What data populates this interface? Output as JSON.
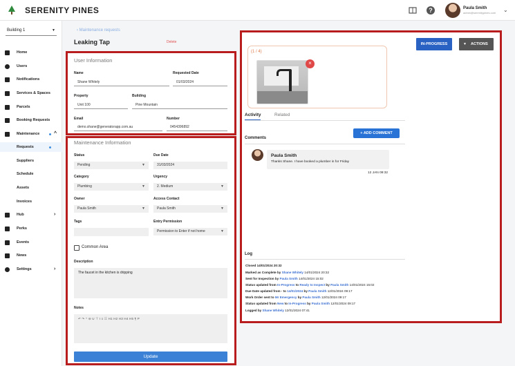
{
  "app": {
    "brand": "SERENITY PINES"
  },
  "user": {
    "name": "Paula Smith",
    "email": "admin@serenitypines.com"
  },
  "sidebar": {
    "building": "Building 1",
    "items": [
      {
        "label": "Home",
        "icon": "home-icon"
      },
      {
        "label": "Users",
        "icon": "user-icon"
      },
      {
        "label": "Notifications",
        "icon": "megaphone-icon"
      },
      {
        "label": "Services & Spaces",
        "icon": "briefcase-icon"
      },
      {
        "label": "Parcels",
        "icon": "parcel-icon"
      },
      {
        "label": "Booking Requests",
        "icon": "calendar-icon"
      },
      {
        "label": "Maintenance",
        "icon": "wrench-icon"
      },
      {
        "label": "Hub",
        "icon": "grid-icon"
      },
      {
        "label": "Perks",
        "icon": "tag-icon"
      },
      {
        "label": "Events",
        "icon": "crown-icon"
      },
      {
        "label": "News",
        "icon": "news-icon"
      },
      {
        "label": "Settings",
        "icon": "gear-icon"
      }
    ],
    "maintenance_sub": [
      "Requests",
      "Suppliers",
      "Schedule",
      "Assets",
      "Invoices"
    ]
  },
  "header": {
    "back": "Maintenance requests",
    "title": "Leaking Tap",
    "delete": "Delete"
  },
  "user_info": {
    "section": "User Information",
    "name_label": "Name",
    "name": "Shane Whitely",
    "req_date_label": "Requested Date",
    "req_date": "01/03/2024",
    "property_label": "Property",
    "property": "Unit 100",
    "building_label": "Building",
    "building": "Pine Mountain",
    "email_label": "Email",
    "email": "demo.shane@generatorapp.com.au",
    "number_label": "Number",
    "number": "0454396892"
  },
  "maint_info": {
    "section": "Maintenance Information",
    "status_label": "Status",
    "status": "Pending",
    "due_label": "Due Date",
    "due": "31/03/2024",
    "category_label": "Category",
    "category": "Plumbing",
    "urgency_label": "Urgency",
    "urgency": "2. Medium",
    "owner_label": "Owner",
    "owner": "Paula Smith",
    "access_label": "Access Contact",
    "access": "Paula Smith",
    "tags_label": "Tags",
    "entry_label": "Entry Permission",
    "entry": "Permission to Enter if not home",
    "common_area": "Common Area",
    "desc_label": "Description",
    "desc": "The faucet in the kitchen is dripping",
    "notes_label": "Notes",
    "toolbar": "↶ ↷ ⁼ ⊖ U ⊤ I ≡ ☷ H1 H2 H3 H4 H5 ¶ P",
    "update": "Update"
  },
  "panel": {
    "photo_count": "(1 / 4)",
    "in_progress": "IN-PROGRESS",
    "actions": "ACTIONS",
    "tab_activity": "Activity",
    "tab_related": "Related",
    "comments": "Comments",
    "add_comment": "+ ADD COMMENT",
    "comment": {
      "name": "Paula Smith",
      "text": "Thanks Shane. I have booked a plumber in for Friday",
      "time": "12 JAN 09:32"
    },
    "log_title": "Log",
    "log": {
      "l1": "Closed 14/01/2024 20:32",
      "l2a": "Marked as Complete by ",
      "l2b": "Shane Whitely",
      "l2c": " 14/01/2024 20:32",
      "l3a": "Sent for Inspection by ",
      "l3b": "Paula Smith",
      "l3c": " 14/01/2024 15:02",
      "l4a": "Status updated from ",
      "l4b": "In-Progress",
      "l4c": " to ",
      "l4d": "Ready to Inspect",
      "l4e": " by ",
      "l4f": "Paula Smith",
      "l4g": " 14/01/2024 15:02",
      "l5a": "Due Date updated from  - to ",
      "l5b": "14/01/2024",
      "l5c": " by ",
      "l5d": "Paula Smith",
      "l5e": " 12/01/2024 09:17",
      "l6a": "Work Order sent to ",
      "l6b": "Mr Emergency",
      "l6c": " by ",
      "l6d": "Paula Smith",
      "l6e": " 12/01/2024 09:17",
      "l7a": "Status updated from ",
      "l7b": "New",
      "l7c": " to ",
      "l7d": "In-Progress",
      "l7e": " by ",
      "l7f": "Paula Smith",
      "l7g": " 12/01/2024 09:17",
      "l8a": "Logged by ",
      "l8b": "Shane Whitely",
      "l8c": " 12/01/2024 07:41"
    }
  },
  "colors": {
    "accent": "#2a62c4",
    "danger": "#e05050",
    "highlight": "#b81c1c"
  }
}
